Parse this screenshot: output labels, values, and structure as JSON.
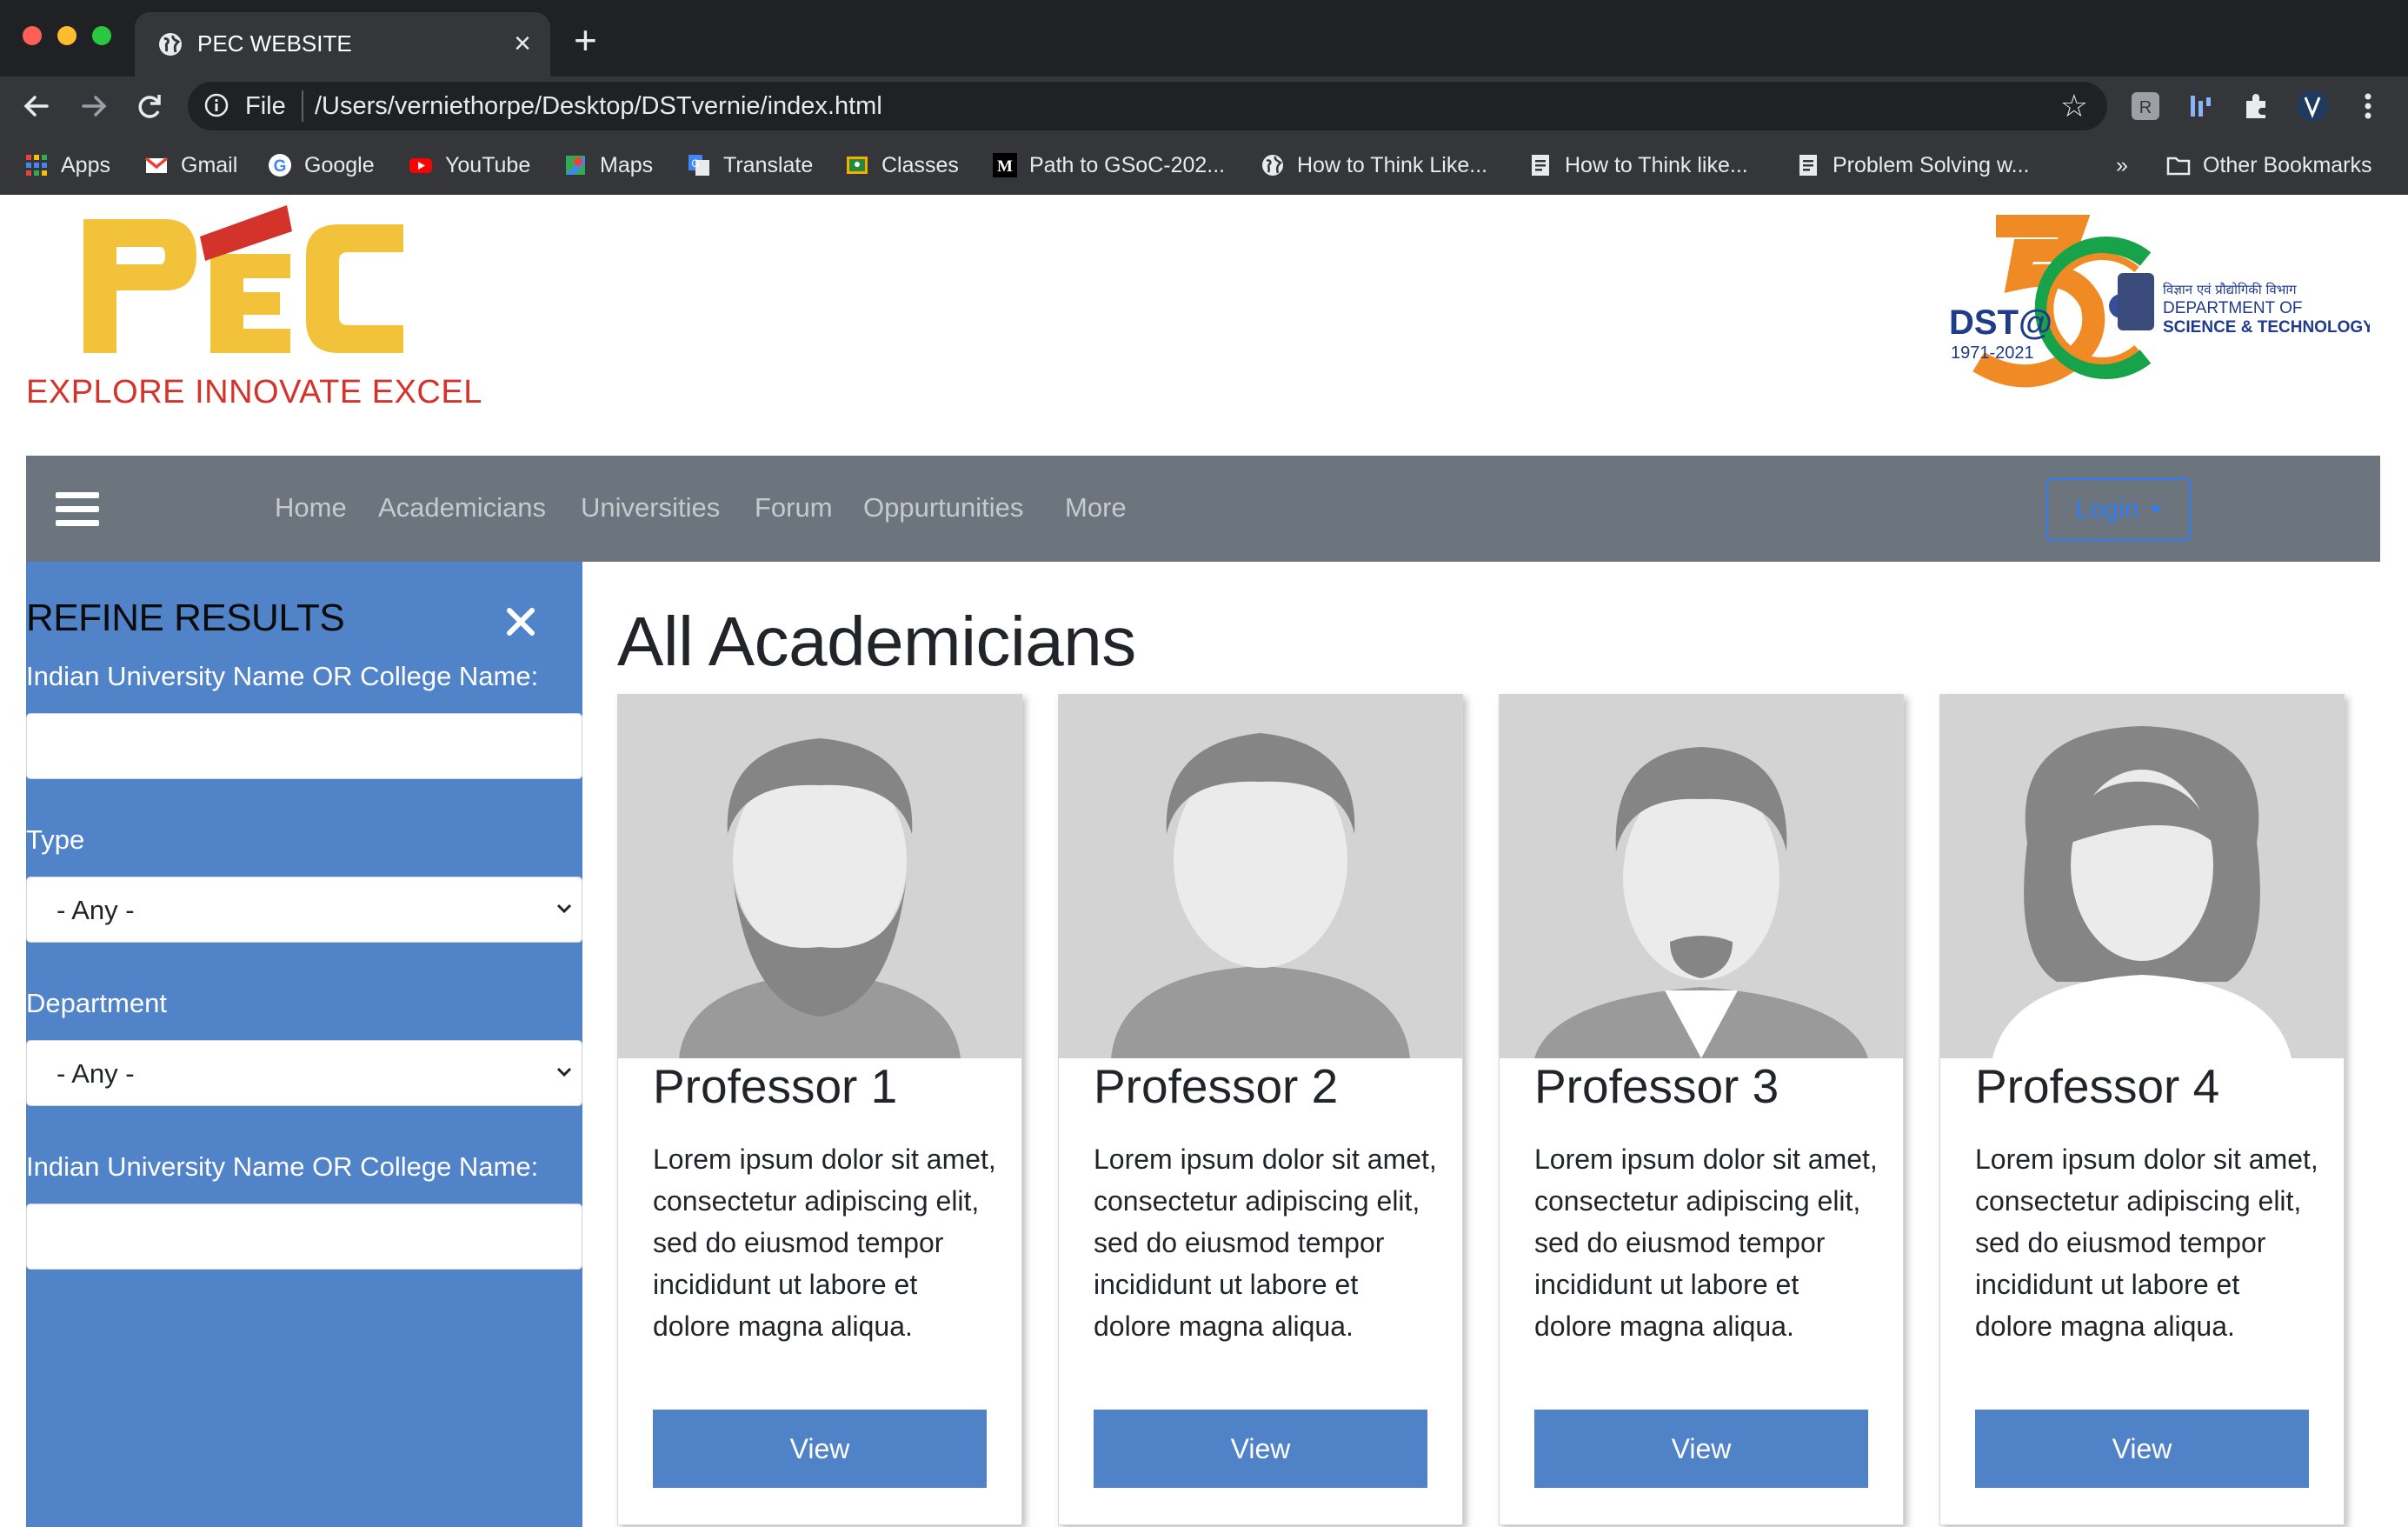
{
  "browser": {
    "tab_title": "PEC WEBSITE",
    "omnibox_scheme": "File",
    "url": "/Users/verniethorpe/Desktop/DSTvernie/index.html",
    "bookmarks": [
      {
        "label": "Apps",
        "icon": "apps-grid-icon"
      },
      {
        "label": "Gmail",
        "icon": "gmail-icon"
      },
      {
        "label": "Google",
        "icon": "google-icon"
      },
      {
        "label": "YouTube",
        "icon": "youtube-icon"
      },
      {
        "label": "Maps",
        "icon": "maps-icon"
      },
      {
        "label": "Translate",
        "icon": "translate-icon"
      },
      {
        "label": "Classes",
        "icon": "classroom-icon"
      },
      {
        "label": "Path to GSoC-202...",
        "icon": "medium-icon"
      },
      {
        "label": "How to Think Like...",
        "icon": "globe-icon"
      },
      {
        "label": "How to Think like...",
        "icon": "document-icon"
      },
      {
        "label": "Problem Solving w...",
        "icon": "document-icon"
      }
    ],
    "overflow_label": "»",
    "other_bookmarks": "Other Bookmarks"
  },
  "header": {
    "logo_text": "PEC",
    "tagline": "EXPLORE INNOVATE EXCEL",
    "dst_logo": {
      "mark": "DST@",
      "years": "1971-2021",
      "hindi": "विज्ञान एवं प्रौद्योगिकी विभाग",
      "line1": "DEPARTMENT OF",
      "line2": "SCIENCE & TECHNOLOGY"
    }
  },
  "nav": {
    "links": [
      "Home",
      "Academicians",
      "Universities",
      "Forum",
      "Oppurtunities",
      "More"
    ],
    "login_label": "Login"
  },
  "sidebar": {
    "title": "REFINE RESULTS",
    "field1_label": "Indian University Name OR College Name:",
    "field1_value": "",
    "type_label": "Type",
    "type_value": "- Any -",
    "department_label": "Department",
    "department_value": "- Any -",
    "field2_label": "Indian University Name OR College Name:",
    "field2_value": ""
  },
  "main": {
    "title": "All Academicians",
    "cards": [
      {
        "name": "Professor 1",
        "text": "Lorem ipsum dolor sit amet, consectetur adipiscing elit, sed do eiusmod tempor incididunt ut labore et dolore magna aliqua.",
        "button": "View"
      },
      {
        "name": "Professor 2",
        "text": "Lorem ipsum dolor sit amet, consectetur adipiscing elit, sed do eiusmod tempor incididunt ut labore et dolore magna aliqua.",
        "button": "View"
      },
      {
        "name": "Professor 3",
        "text": "Lorem ipsum dolor sit amet, consectetur adipiscing elit, sed do eiusmod tempor incididunt ut labore et dolore magna aliqua.",
        "button": "View"
      },
      {
        "name": "Professor 4",
        "text": "Lorem ipsum dolor sit amet, consectetur adipiscing elit, sed do eiusmod tempor incididunt ut labore et dolore magna aliqua.",
        "button": "View"
      }
    ]
  },
  "colors": {
    "sidebar_bg": "#5183c9",
    "navbar_bg": "#6c757d",
    "button_bg": "#4f82c7",
    "login_accent": "#2f7df6",
    "logo_yellow": "#f2c33a",
    "logo_red": "#d4332b"
  }
}
